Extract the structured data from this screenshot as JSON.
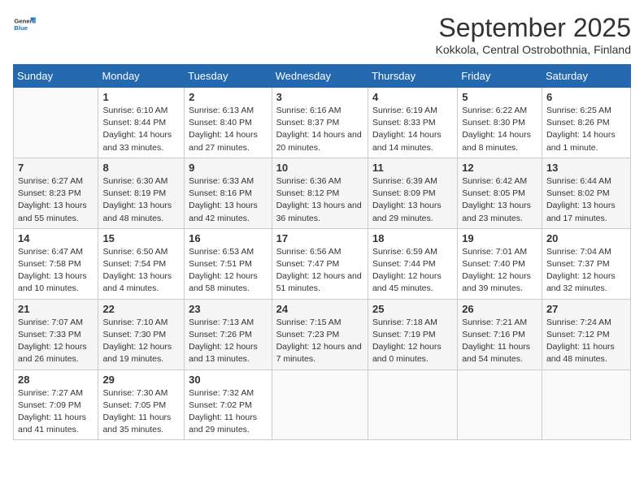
{
  "header": {
    "logo_general": "General",
    "logo_blue": "Blue",
    "title": "September 2025",
    "subtitle": "Kokkola, Central Ostrobothnia, Finland"
  },
  "weekdays": [
    "Sunday",
    "Monday",
    "Tuesday",
    "Wednesday",
    "Thursday",
    "Friday",
    "Saturday"
  ],
  "weeks": [
    [
      {
        "day": "",
        "empty": true
      },
      {
        "day": "1",
        "sunrise": "6:10 AM",
        "sunset": "8:44 PM",
        "daylight": "14 hours and 33 minutes."
      },
      {
        "day": "2",
        "sunrise": "6:13 AM",
        "sunset": "8:40 PM",
        "daylight": "14 hours and 27 minutes."
      },
      {
        "day": "3",
        "sunrise": "6:16 AM",
        "sunset": "8:37 PM",
        "daylight": "14 hours and 20 minutes."
      },
      {
        "day": "4",
        "sunrise": "6:19 AM",
        "sunset": "8:33 PM",
        "daylight": "14 hours and 14 minutes."
      },
      {
        "day": "5",
        "sunrise": "6:22 AM",
        "sunset": "8:30 PM",
        "daylight": "14 hours and 8 minutes."
      },
      {
        "day": "6",
        "sunrise": "6:25 AM",
        "sunset": "8:26 PM",
        "daylight": "14 hours and 1 minute."
      }
    ],
    [
      {
        "day": "7",
        "sunrise": "6:27 AM",
        "sunset": "8:23 PM",
        "daylight": "13 hours and 55 minutes."
      },
      {
        "day": "8",
        "sunrise": "6:30 AM",
        "sunset": "8:19 PM",
        "daylight": "13 hours and 48 minutes."
      },
      {
        "day": "9",
        "sunrise": "6:33 AM",
        "sunset": "8:16 PM",
        "daylight": "13 hours and 42 minutes."
      },
      {
        "day": "10",
        "sunrise": "6:36 AM",
        "sunset": "8:12 PM",
        "daylight": "13 hours and 36 minutes."
      },
      {
        "day": "11",
        "sunrise": "6:39 AM",
        "sunset": "8:09 PM",
        "daylight": "13 hours and 29 minutes."
      },
      {
        "day": "12",
        "sunrise": "6:42 AM",
        "sunset": "8:05 PM",
        "daylight": "13 hours and 23 minutes."
      },
      {
        "day": "13",
        "sunrise": "6:44 AM",
        "sunset": "8:02 PM",
        "daylight": "13 hours and 17 minutes."
      }
    ],
    [
      {
        "day": "14",
        "sunrise": "6:47 AM",
        "sunset": "7:58 PM",
        "daylight": "13 hours and 10 minutes."
      },
      {
        "day": "15",
        "sunrise": "6:50 AM",
        "sunset": "7:54 PM",
        "daylight": "13 hours and 4 minutes."
      },
      {
        "day": "16",
        "sunrise": "6:53 AM",
        "sunset": "7:51 PM",
        "daylight": "12 hours and 58 minutes."
      },
      {
        "day": "17",
        "sunrise": "6:56 AM",
        "sunset": "7:47 PM",
        "daylight": "12 hours and 51 minutes."
      },
      {
        "day": "18",
        "sunrise": "6:59 AM",
        "sunset": "7:44 PM",
        "daylight": "12 hours and 45 minutes."
      },
      {
        "day": "19",
        "sunrise": "7:01 AM",
        "sunset": "7:40 PM",
        "daylight": "12 hours and 39 minutes."
      },
      {
        "day": "20",
        "sunrise": "7:04 AM",
        "sunset": "7:37 PM",
        "daylight": "12 hours and 32 minutes."
      }
    ],
    [
      {
        "day": "21",
        "sunrise": "7:07 AM",
        "sunset": "7:33 PM",
        "daylight": "12 hours and 26 minutes."
      },
      {
        "day": "22",
        "sunrise": "7:10 AM",
        "sunset": "7:30 PM",
        "daylight": "12 hours and 19 minutes."
      },
      {
        "day": "23",
        "sunrise": "7:13 AM",
        "sunset": "7:26 PM",
        "daylight": "12 hours and 13 minutes."
      },
      {
        "day": "24",
        "sunrise": "7:15 AM",
        "sunset": "7:23 PM",
        "daylight": "12 hours and 7 minutes."
      },
      {
        "day": "25",
        "sunrise": "7:18 AM",
        "sunset": "7:19 PM",
        "daylight": "12 hours and 0 minutes."
      },
      {
        "day": "26",
        "sunrise": "7:21 AM",
        "sunset": "7:16 PM",
        "daylight": "11 hours and 54 minutes."
      },
      {
        "day": "27",
        "sunrise": "7:24 AM",
        "sunset": "7:12 PM",
        "daylight": "11 hours and 48 minutes."
      }
    ],
    [
      {
        "day": "28",
        "sunrise": "7:27 AM",
        "sunset": "7:09 PM",
        "daylight": "11 hours and 41 minutes."
      },
      {
        "day": "29",
        "sunrise": "7:30 AM",
        "sunset": "7:05 PM",
        "daylight": "11 hours and 35 minutes."
      },
      {
        "day": "30",
        "sunrise": "7:32 AM",
        "sunset": "7:02 PM",
        "daylight": "11 hours and 29 minutes."
      },
      {
        "day": "",
        "empty": true
      },
      {
        "day": "",
        "empty": true
      },
      {
        "day": "",
        "empty": true
      },
      {
        "day": "",
        "empty": true
      }
    ]
  ]
}
